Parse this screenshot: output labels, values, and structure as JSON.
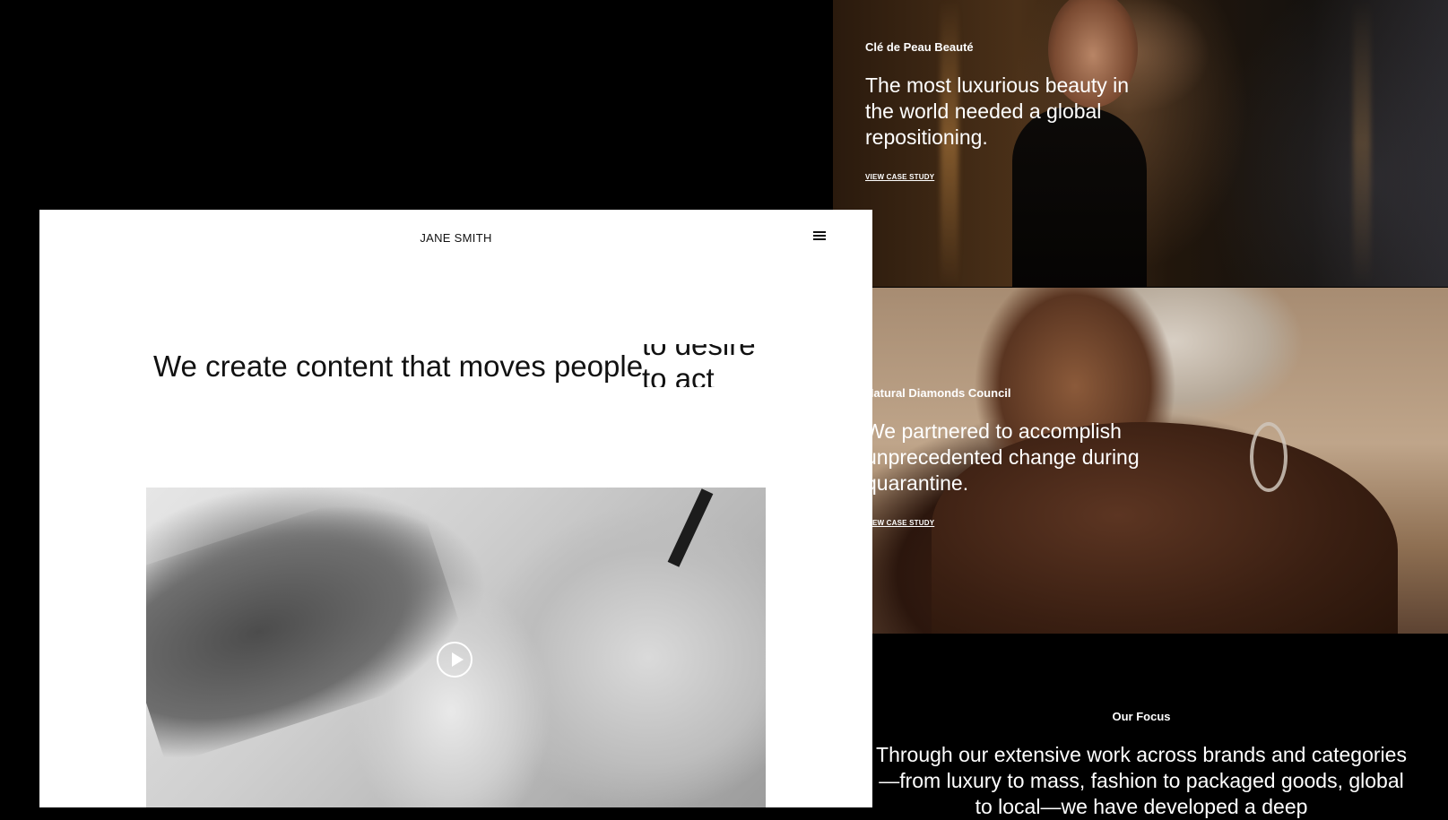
{
  "header": {
    "brand": "JANE SMITH",
    "menu_icon": "hamburger-menu-icon"
  },
  "hero": {
    "headline": "We create content that moves people",
    "rotating_words": [
      "to desire",
      "to act"
    ]
  },
  "video": {
    "play_icon": "play-icon"
  },
  "case_studies": [
    {
      "client": "Clé de Peau Beauté",
      "headline": "The most luxurious beauty in the world needed a global repositioning.",
      "link_label": "VIEW CASE STUDY"
    },
    {
      "client": "Natural Diamonds Council",
      "headline": "We partnered to accomplish unprecedented change during quarantine.",
      "link_label": "VIEW CASE STUDY"
    }
  ],
  "focus": {
    "label": "Our Focus",
    "text": "Through our extensive work across brands and categories —from luxury to mass, fashion to packaged goods, global to local—we have developed a deep"
  }
}
